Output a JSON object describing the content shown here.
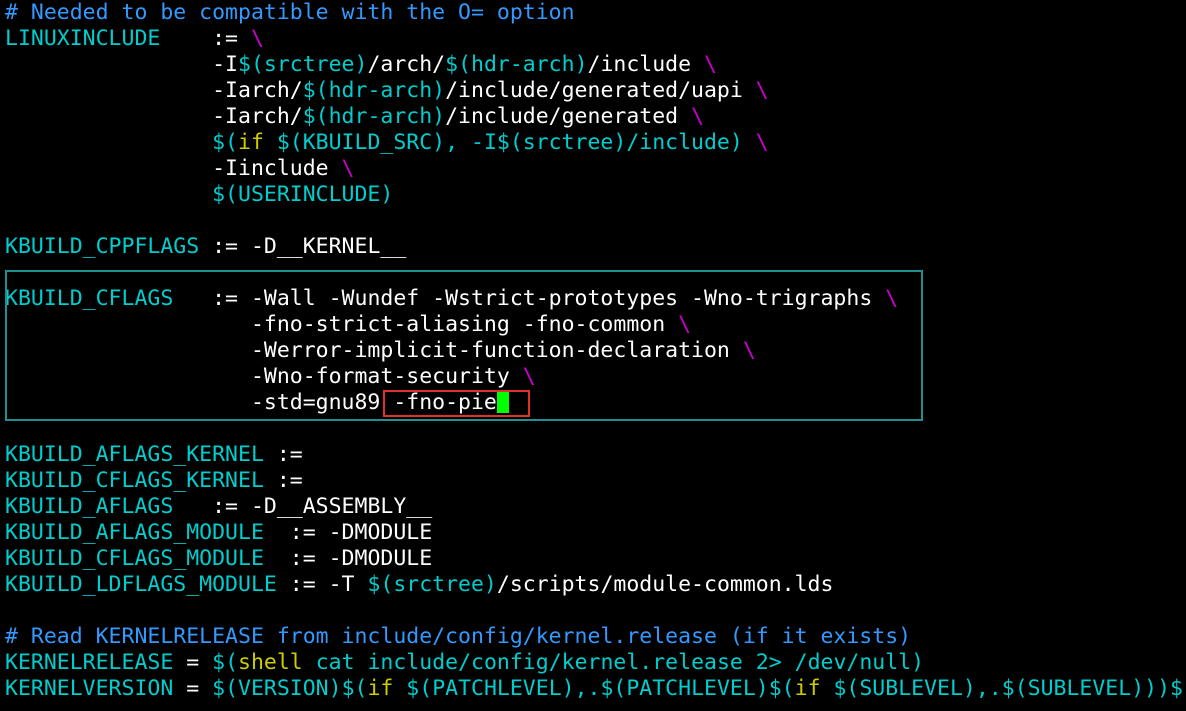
{
  "editor": {
    "colors": {
      "background": "#000000",
      "comment": "#3399ff",
      "variable": "#00cdcd",
      "text": "#ffffff",
      "continuation": "#cd00cd",
      "keyword": "#cdcd00",
      "cursor": "#00ff00",
      "highlight_box": "#1f8f8f",
      "selection_box": "#e0302a"
    },
    "lines": [
      [
        {
          "t": "# Needed to be compatible with the O= option",
          "c": "comment"
        }
      ],
      [
        {
          "t": "LINUXINCLUDE    ",
          "c": "var"
        },
        {
          "t": ":= ",
          "c": "white"
        },
        {
          "t": "\\",
          "c": "magenta"
        }
      ],
      [
        {
          "t": "                -I",
          "c": "white"
        },
        {
          "t": "$(srctree)",
          "c": "var"
        },
        {
          "t": "/arch/",
          "c": "white"
        },
        {
          "t": "$(hdr-arch)",
          "c": "var"
        },
        {
          "t": "/include ",
          "c": "white"
        },
        {
          "t": "\\",
          "c": "magenta"
        }
      ],
      [
        {
          "t": "                -Iarch/",
          "c": "white"
        },
        {
          "t": "$(hdr-arch)",
          "c": "var"
        },
        {
          "t": "/include/generated/uapi ",
          "c": "white"
        },
        {
          "t": "\\",
          "c": "magenta"
        }
      ],
      [
        {
          "t": "                -Iarch/",
          "c": "white"
        },
        {
          "t": "$(hdr-arch)",
          "c": "var"
        },
        {
          "t": "/include/generated ",
          "c": "white"
        },
        {
          "t": "\\",
          "c": "magenta"
        }
      ],
      [
        {
          "t": "                $(",
          "c": "var"
        },
        {
          "t": "if",
          "c": "yellow"
        },
        {
          "t": " $(KBUILD_SRC), -I$(srctree)/include) ",
          "c": "var"
        },
        {
          "t": "\\",
          "c": "magenta"
        }
      ],
      [
        {
          "t": "                -Iinclude ",
          "c": "white"
        },
        {
          "t": "\\",
          "c": "magenta"
        }
      ],
      [
        {
          "t": "                $(USERINCLUDE)",
          "c": "var"
        }
      ],
      [
        {
          "t": "",
          "c": "white"
        }
      ],
      [
        {
          "t": "KBUILD_CPPFLAGS",
          "c": "var"
        },
        {
          "t": " := -D__KERNEL__",
          "c": "white"
        }
      ],
      [
        {
          "t": "",
          "c": "white"
        }
      ],
      [
        {
          "t": "KBUILD_CFLAGS",
          "c": "var"
        },
        {
          "t": "   := -Wall -Wundef -Wstrict-prototypes -Wno-trigraphs ",
          "c": "white"
        },
        {
          "t": "\\",
          "c": "magenta"
        }
      ],
      [
        {
          "t": "                   -fno-strict-aliasing -fno-common ",
          "c": "white"
        },
        {
          "t": "\\",
          "c": "magenta"
        }
      ],
      [
        {
          "t": "                   -Werror-implicit-function-declaration ",
          "c": "white"
        },
        {
          "t": "\\",
          "c": "magenta"
        }
      ],
      [
        {
          "t": "                   -Wno-format-security ",
          "c": "white"
        },
        {
          "t": "\\",
          "c": "magenta"
        }
      ],
      [
        {
          "t": "                   -std=gnu89 -fno-pie",
          "c": "white"
        },
        {
          "cursor": true
        }
      ],
      [
        {
          "t": "",
          "c": "white"
        }
      ],
      [
        {
          "t": "KBUILD_AFLAGS_KERNEL",
          "c": "var"
        },
        {
          "t": " :=",
          "c": "white"
        }
      ],
      [
        {
          "t": "KBUILD_CFLAGS_KERNEL",
          "c": "var"
        },
        {
          "t": " :=",
          "c": "white"
        }
      ],
      [
        {
          "t": "KBUILD_AFLAGS",
          "c": "var"
        },
        {
          "t": "   := -D__ASSEMBLY__",
          "c": "white"
        }
      ],
      [
        {
          "t": "KBUILD_AFLAGS_MODULE",
          "c": "var"
        },
        {
          "t": "  := -DMODULE",
          "c": "white"
        }
      ],
      [
        {
          "t": "KBUILD_CFLAGS_MODULE",
          "c": "var"
        },
        {
          "t": "  := -DMODULE",
          "c": "white"
        }
      ],
      [
        {
          "t": "KBUILD_LDFLAGS_MODULE",
          "c": "var"
        },
        {
          "t": " := -T ",
          "c": "white"
        },
        {
          "t": "$(srctree)",
          "c": "var"
        },
        {
          "t": "/scripts/module-common.lds",
          "c": "white"
        }
      ],
      [
        {
          "t": "",
          "c": "white"
        }
      ],
      [
        {
          "t": "# Read KERNELRELEASE from include/config/kernel.release (if it exists)",
          "c": "comment"
        }
      ],
      [
        {
          "t": "KERNELRELEASE",
          "c": "var"
        },
        {
          "t": " = ",
          "c": "white"
        },
        {
          "t": "$(",
          "c": "var"
        },
        {
          "t": "shell",
          "c": "yellow"
        },
        {
          "t": " cat include/config/kernel.release 2> /dev/null)",
          "c": "var"
        }
      ],
      [
        {
          "t": "KERNELVERSION",
          "c": "var"
        },
        {
          "t": " = ",
          "c": "white"
        },
        {
          "t": "$(VERSION)$(",
          "c": "var"
        },
        {
          "t": "if",
          "c": "yellow"
        },
        {
          "t": " $(PATCHLEVEL),.$(PATCHLEVEL)$(",
          "c": "var"
        },
        {
          "t": "if",
          "c": "yellow"
        },
        {
          "t": " $(SUBLEVEL),.$(SUBLEVEL)))$(",
          "c": "var"
        }
      ]
    ]
  }
}
